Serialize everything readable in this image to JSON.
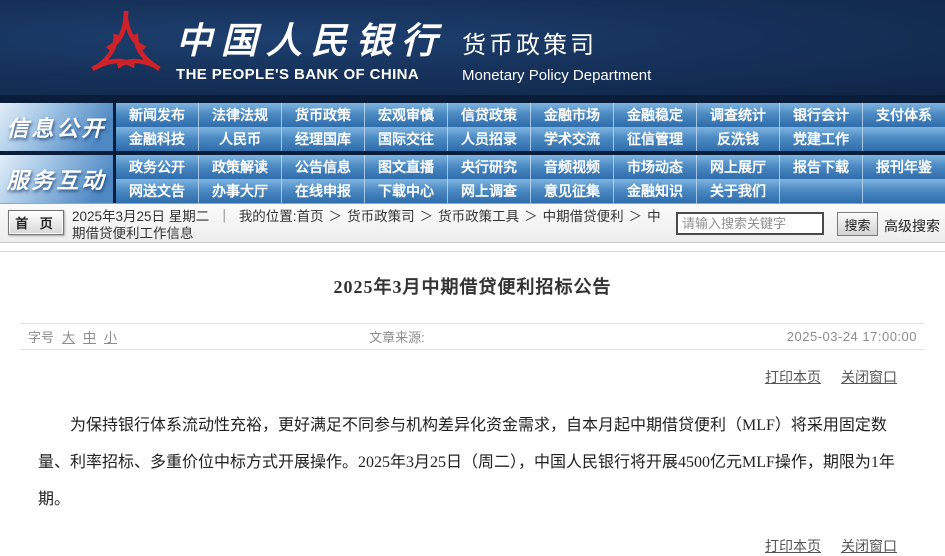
{
  "header": {
    "bank_name_cn": "中国人民银行",
    "bank_name_en": "THE PEOPLE'S BANK OF CHINA",
    "dept_cn": "货币政策司",
    "dept_en": "Monetary Policy Department"
  },
  "nav": {
    "sections": [
      {
        "label": "信息公开",
        "rows": [
          [
            "新闻发布",
            "法律法规",
            "货币政策",
            "宏观审慎",
            "信贷政策",
            "金融市场",
            "金融稳定",
            "调查统计",
            "银行会计",
            "支付体系"
          ],
          [
            "金融科技",
            "人民币",
            "经理国库",
            "国际交往",
            "人员招录",
            "学术交流",
            "征信管理",
            "反洗钱",
            "党建工作",
            ""
          ]
        ]
      },
      {
        "label": "服务互动",
        "rows": [
          [
            "政务公开",
            "政策解读",
            "公告信息",
            "图文直播",
            "央行研究",
            "音频视频",
            "市场动态",
            "网上展厅",
            "报告下载",
            "报刊年鉴"
          ],
          [
            "网送文告",
            "办事大厅",
            "在线申报",
            "下载中心",
            "网上调查",
            "意见征集",
            "金融知识",
            "关于我们",
            "",
            ""
          ]
        ]
      }
    ]
  },
  "breadcrumb": {
    "home_button": "首 页",
    "date": "2025年3月25日 星期二",
    "divider": "｜",
    "location_label": "我的位置:首页",
    "path_separator": "＞",
    "path": [
      "货币政策司",
      "货币政策工具",
      "中期借贷便利",
      "中期借贷便利工作信息"
    ]
  },
  "search": {
    "placeholder": "请输入搜索关键字",
    "button_label": "搜索",
    "advanced_label": "高级搜索"
  },
  "article": {
    "title": "2025年3月中期借贷便利招标公告",
    "font_size_label": "字号",
    "font_sizes": [
      "大",
      "中",
      "小"
    ],
    "source_label": "文章来源:",
    "datetime": "2025-03-24 17:00:00",
    "print_label": "打印本页",
    "close_label": "关闭窗口",
    "body": "为保持银行体系流动性充裕，更好满足不同参与机构差异化资金需求，自本月起中期借贷便利（MLF）将采用固定数量、利率招标、多重价位中标方式开展操作。2025年3月25日（周二），中国人民银行将开展4500亿元MLF操作，期限为1年期。"
  },
  "colors": {
    "header_navy": "#16325b",
    "nav_blue": "#4a88c2",
    "nav_gap_navy": "#0a1e3c",
    "emblem_red": "#cf2128",
    "crumb_bar_gray": "#ededed",
    "text_dark": "#333333",
    "meta_gray": "#8c8c8c"
  }
}
